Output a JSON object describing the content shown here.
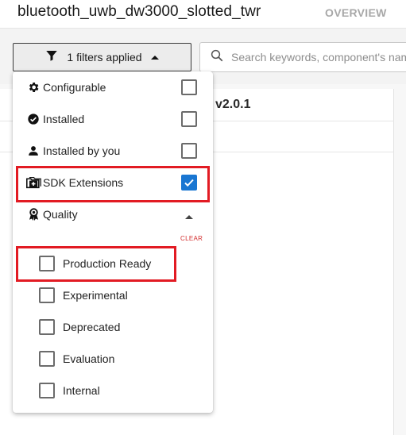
{
  "header": {
    "project_title": "bluetooth_uwb_dw3000_slotted_twr",
    "tab_overview": "OVERVIEW"
  },
  "toolbar": {
    "filter_label": "1 filters applied",
    "search_placeholder": "Search keywords, component's name"
  },
  "background": {
    "version_label": "v2.0.1"
  },
  "filters": {
    "items": [
      {
        "label": "Configurable",
        "icon": "gear-icon",
        "checked": false
      },
      {
        "label": "Installed",
        "icon": "check-circle-icon",
        "checked": false
      },
      {
        "label": "Installed by you",
        "icon": "person-icon",
        "checked": false
      },
      {
        "label": "SDK Extensions",
        "icon": "folder-plus-icon",
        "checked": true
      }
    ],
    "quality": {
      "label": "Quality",
      "icon": "ribbon-icon",
      "clear_label": "CLEAR",
      "options": [
        {
          "label": "Production Ready",
          "checked": false
        },
        {
          "label": "Experimental",
          "checked": false
        },
        {
          "label": "Deprecated",
          "checked": false
        },
        {
          "label": "Evaluation",
          "checked": false
        },
        {
          "label": "Internal",
          "checked": false
        }
      ]
    }
  },
  "colors": {
    "accent": "#1976d2",
    "highlight": "#e21b23",
    "clear": "#d32f2f"
  }
}
